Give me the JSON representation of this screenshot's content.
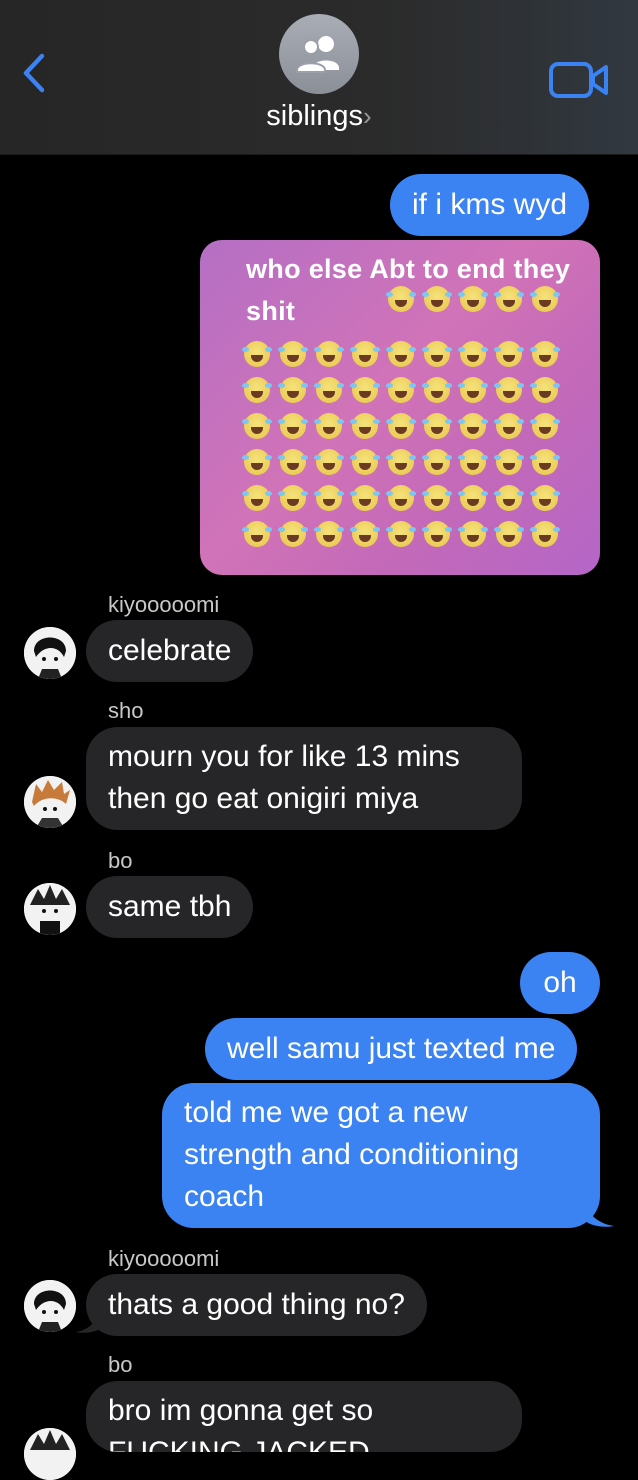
{
  "header": {
    "title": "siblings",
    "title_chevron": "›"
  },
  "messages": {
    "m1": "if i kms wyd",
    "meme_caption": "who else Abt to end they shit",
    "sender1": "kiyooooomi",
    "m2": "celebrate",
    "sender2": "sho",
    "m3_line1": "mourn you for like 13 mins",
    "m3_line2": "then go eat onigiri miya",
    "sender3": "bo",
    "m4": "same tbh",
    "m5": "oh",
    "m6": "well samu just texted me",
    "m7_line1": "told me we got a new",
    "m7_line2": "strength and conditioning",
    "m7_line3": "coach",
    "sender4": "kiyooooomi",
    "m8": "thats a good thing no?",
    "sender5": "bo",
    "m9_line1": "bro im gonna get so",
    "m9_line2": "FUCKING JACKED"
  },
  "colors": {
    "outgoing": "#3b82f2",
    "incoming": "#262628",
    "accent": "#3b82f2"
  },
  "icons": {
    "back": "chevron-left-icon",
    "group": "group-icon",
    "video": "video-camera-icon"
  }
}
